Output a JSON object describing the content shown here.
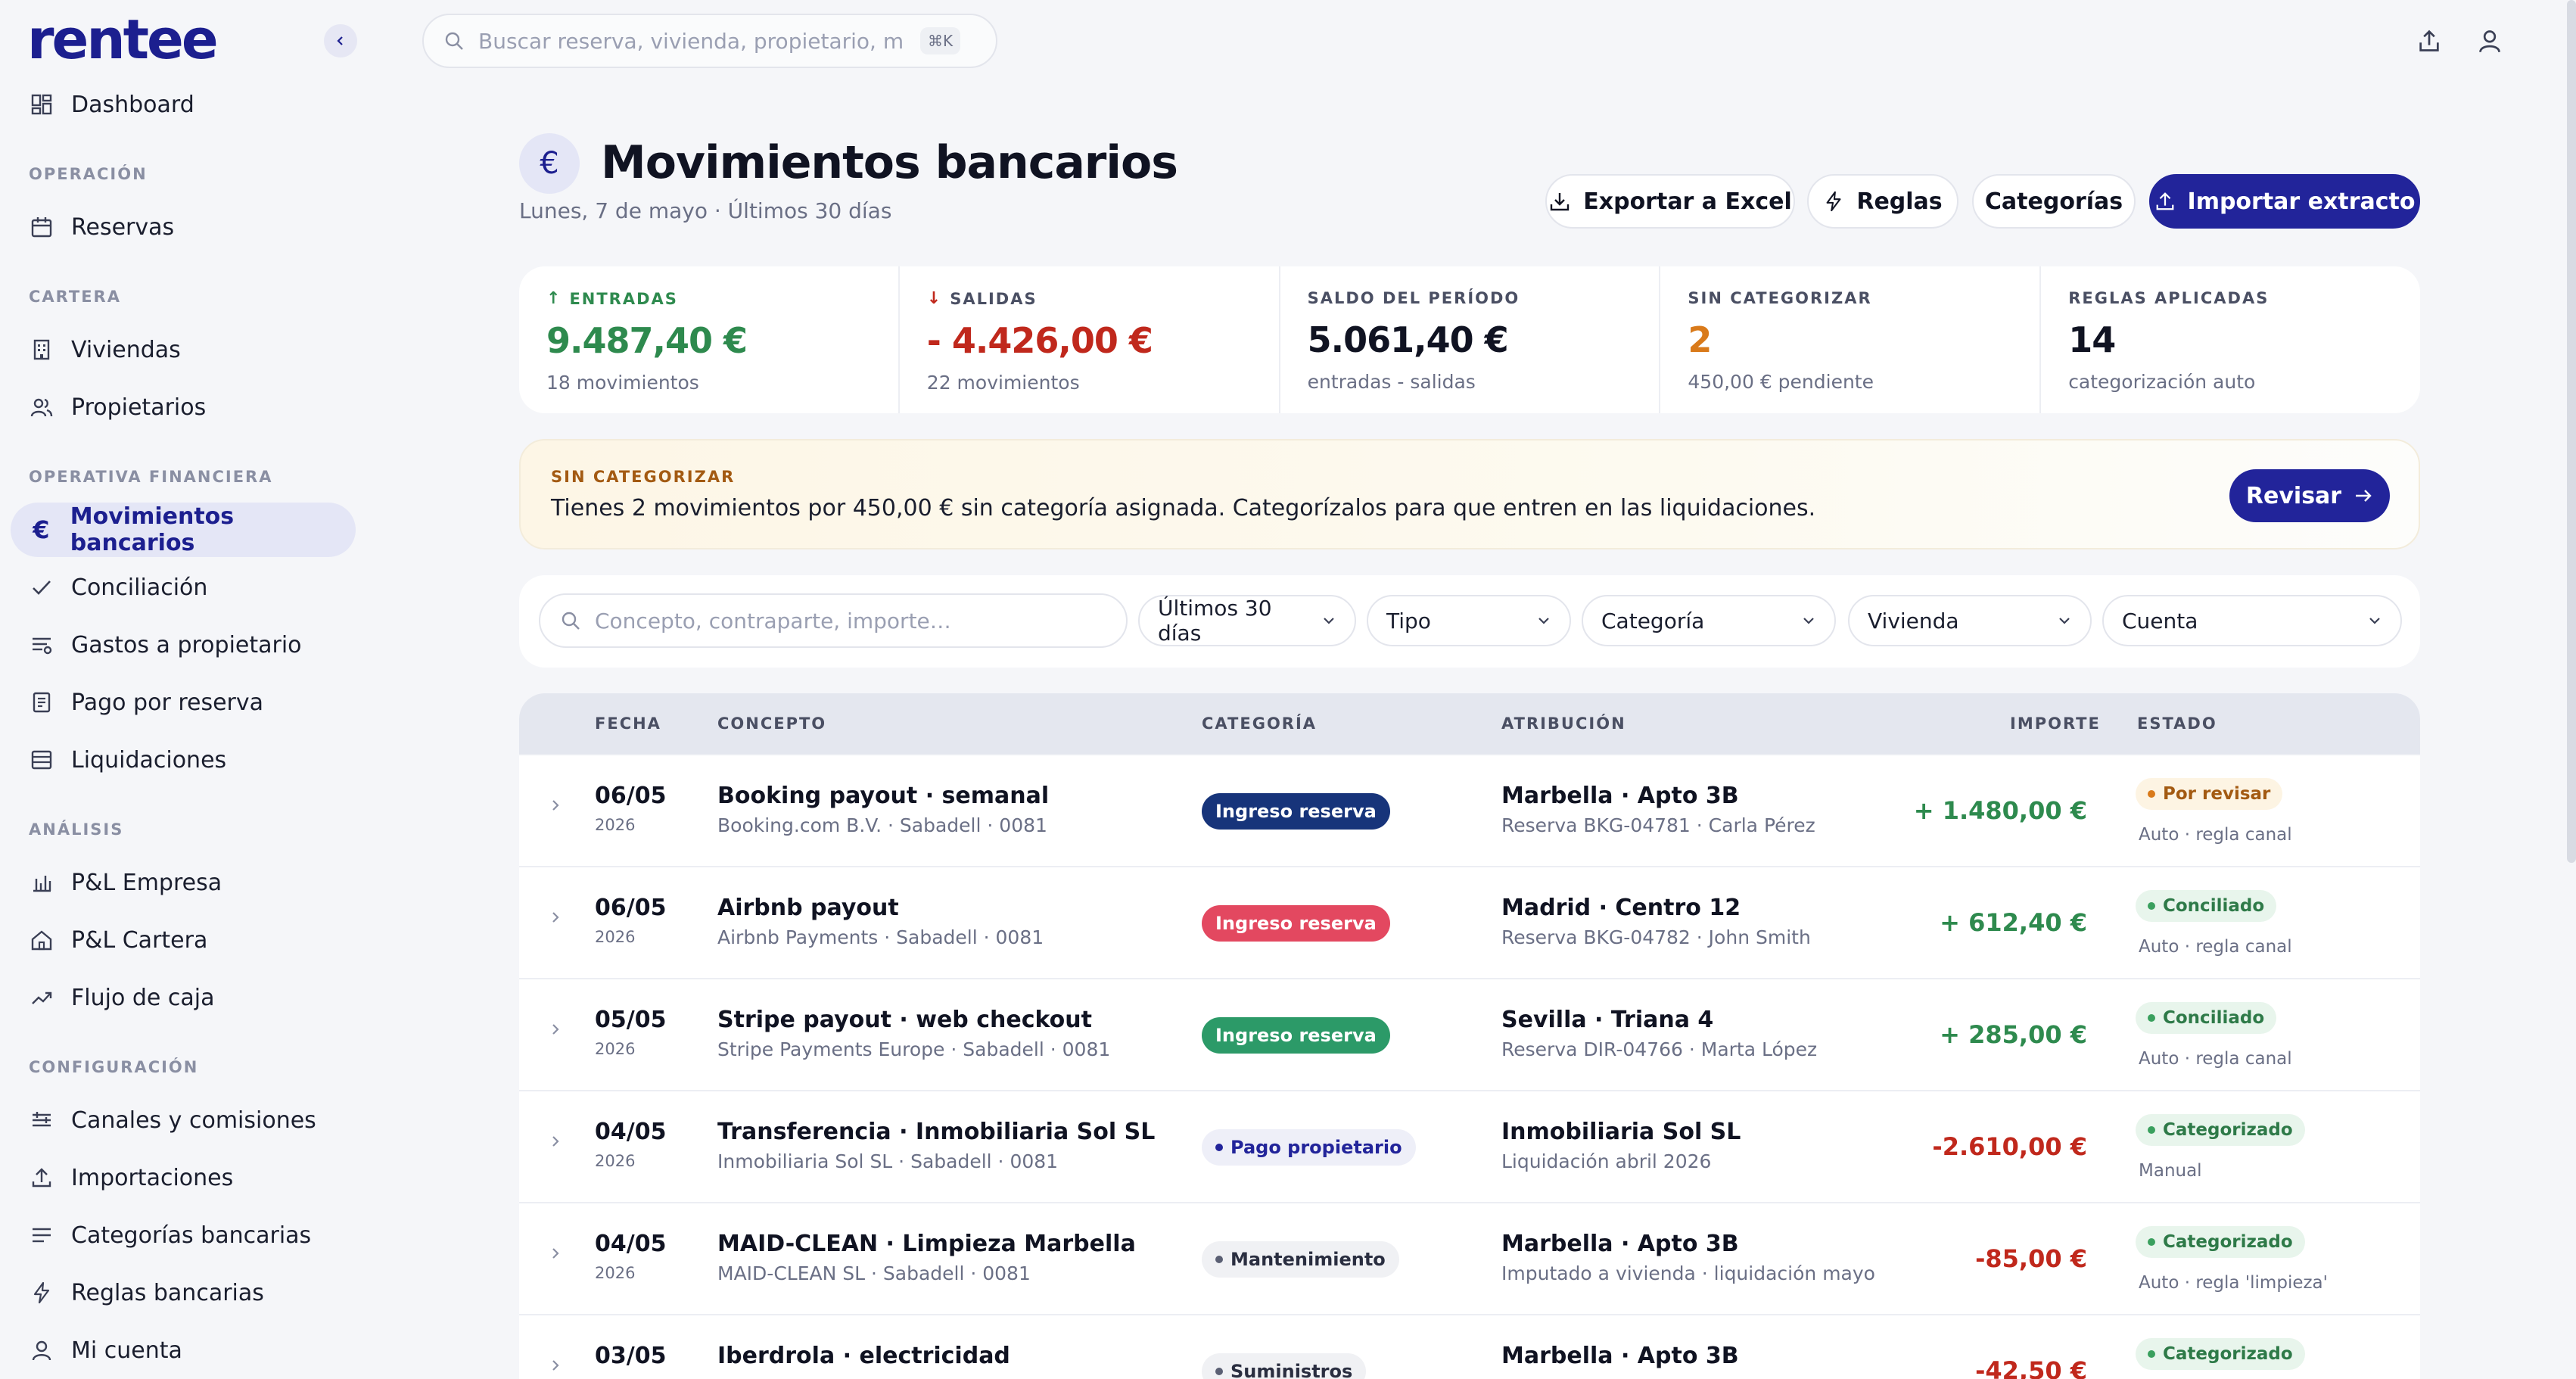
{
  "app": {
    "logo": "rentee"
  },
  "search_top": {
    "placeholder": "Buscar reserva, vivienda, propietario, movir",
    "shortcut": "⌘K"
  },
  "sidebar": {
    "dashboard": "Dashboard",
    "sections": {
      "operacion": "OPERACIÓN",
      "cartera": "CARTERA",
      "operativa": "OPERATIVA FINANCIERA",
      "analisis": "ANÁLISIS",
      "config": "CONFIGURACIÓN"
    },
    "items": {
      "reservas": "Reservas",
      "viviendas": "Viviendas",
      "propietarios": "Propietarios",
      "movimientos": "Movimientos bancarios",
      "conciliacion": "Conciliación",
      "gastos": "Gastos a propietario",
      "pago": "Pago por reserva",
      "liquidaciones": "Liquidaciones",
      "pl_empresa": "P&L Empresa",
      "pl_cartera": "P&L Cartera",
      "flujo": "Flujo de caja",
      "canales": "Canales y comisiones",
      "importaciones": "Importaciones",
      "categorias": "Categorías bancarias",
      "reglas": "Reglas bancarias",
      "cuenta": "Mi cuenta"
    }
  },
  "header": {
    "title": "Movimientos bancarios",
    "subtitle": "Lunes, 7 de mayo · Últimos 30 días",
    "buttons": {
      "export": "Exportar a Excel",
      "rules": "Reglas",
      "categories": "Categorías",
      "import": "Importar extracto"
    }
  },
  "stats": {
    "entradas": {
      "label": "ENTRADAS",
      "value": "9.487,40 €",
      "sub": "18 movimientos"
    },
    "salidas": {
      "label": "SALIDAS",
      "value": "- 4.426,00 €",
      "sub": "22 movimientos"
    },
    "saldo": {
      "label": "SALDO DEL PERÍODO",
      "value": "5.061,40 €",
      "sub": "entradas - salidas"
    },
    "sin_cat": {
      "label": "SIN CATEGORIZAR",
      "value": "2",
      "sub": "450,00 € pendiente"
    },
    "reglas": {
      "label": "REGLAS APLICADAS",
      "value": "14",
      "sub": "categorización auto"
    }
  },
  "alert": {
    "label": "SIN CATEGORIZAR",
    "text": "Tienes 2 movimientos por 450,00 € sin categoría asignada. Categorízalos para que entren en las liquidaciones.",
    "button": "Revisar"
  },
  "filters": {
    "search_placeholder": "Concepto, contraparte, importe…",
    "period": "Últimos 30 días",
    "type": "Tipo",
    "category": "Categoría",
    "property": "Vivienda",
    "account": "Cuenta"
  },
  "table": {
    "headers": {
      "date": "FECHA",
      "concept": "CONCEPTO",
      "category": "CATEGORÍA",
      "attribution": "ATRIBUCIÓN",
      "amount": "IMPORTE",
      "status": "ESTADO"
    },
    "rows": [
      {
        "date": "06/05",
        "year": "2026",
        "concept": "Booking payout · semanal",
        "counterparty": "Booking.com B.V. · Sabadell · 0081",
        "category": "Ingreso reserva",
        "attribution": "Marbella · Apto 3B",
        "attribution_sub": "Reserva BKG-04781 · Carla Pérez",
        "amount": "+ 1.480,00 €",
        "status": "Por revisar",
        "status_note": "Auto · regla canal"
      },
      {
        "date": "06/05",
        "year": "2026",
        "concept": "Airbnb payout",
        "counterparty": "Airbnb Payments · Sabadell · 0081",
        "category": "Ingreso reserva",
        "attribution": "Madrid · Centro 12",
        "attribution_sub": "Reserva BKG-04782 · John Smith",
        "amount": "+ 612,40 €",
        "status": "Conciliado",
        "status_note": "Auto · regla canal"
      },
      {
        "date": "05/05",
        "year": "2026",
        "concept": "Stripe payout · web checkout",
        "counterparty": "Stripe Payments Europe · Sabadell · 0081",
        "category": "Ingreso reserva",
        "attribution": "Sevilla · Triana 4",
        "attribution_sub": "Reserva DIR-04766 · Marta López",
        "amount": "+ 285,00 €",
        "status": "Conciliado",
        "status_note": "Auto · regla canal"
      },
      {
        "date": "04/05",
        "year": "2026",
        "concept": "Transferencia · Inmobiliaria Sol SL",
        "counterparty": "Inmobiliaria Sol SL · Sabadell · 0081",
        "category": "Pago propietario",
        "attribution": "Inmobiliaria Sol SL",
        "attribution_sub": "Liquidación abril 2026",
        "amount": "-2.610,00 €",
        "status": "Categorizado",
        "status_note": "Manual"
      },
      {
        "date": "04/05",
        "year": "2026",
        "concept": "MAID-CLEAN · Limpieza Marbella",
        "counterparty": "MAID-CLEAN SL · Sabadell · 0081",
        "category": "Mantenimiento",
        "attribution": "Marbella · Apto 3B",
        "attribution_sub": "Imputado a vivienda · liquidación mayo",
        "amount": "-85,00 €",
        "status": "Categorizado",
        "status_note": "Auto · regla 'limpieza'"
      },
      {
        "date": "03/05",
        "year": "2026",
        "concept": "Iberdrola · electricidad",
        "counterparty": "",
        "category": "Suministros",
        "attribution": "Marbella · Apto 3B",
        "attribution_sub": "",
        "amount": "-42,50 €",
        "status": "Categorizado",
        "status_note": ""
      }
    ]
  },
  "colors": {
    "primary": "#22249a",
    "positive": "#2e8a4e",
    "negative": "#c0281c",
    "warning": "#d97a1a"
  }
}
